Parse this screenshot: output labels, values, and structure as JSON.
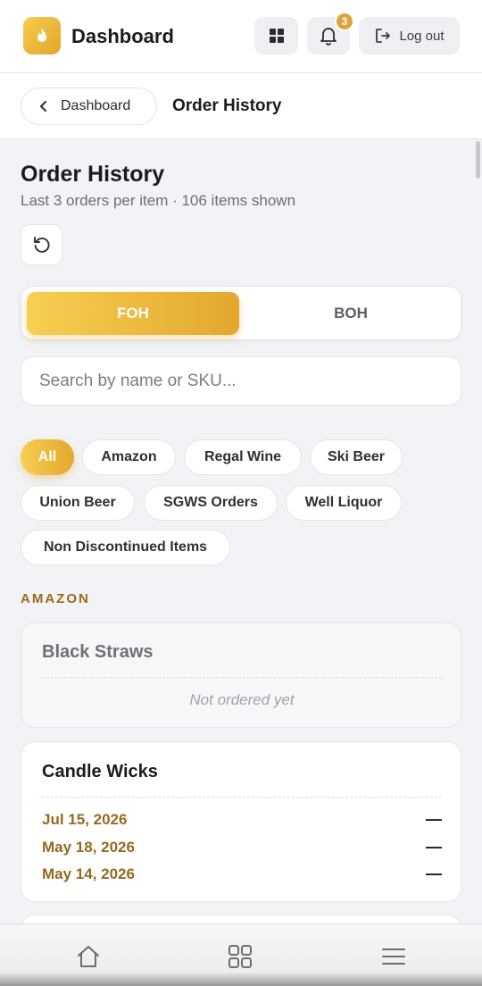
{
  "header": {
    "title": "Dashboard",
    "notification_count": "3",
    "logout_label": "Log out"
  },
  "breadcrumb": {
    "back_label": "Dashboard",
    "current": "Order History"
  },
  "page": {
    "title": "Order History",
    "subtitle": "Last 3 orders per item · 106 items shown"
  },
  "segments": {
    "foh": "FOH",
    "boh": "BOH",
    "active": "FOH"
  },
  "search": {
    "placeholder": "Search by name or SKU...",
    "value": ""
  },
  "filters": [
    "All",
    "Amazon",
    "Regal Wine",
    "Ski Beer",
    "Union Beer",
    "SGWS Orders",
    "Well Liquor",
    "Non Discontinued Items"
  ],
  "active_filter": "All",
  "section": {
    "label": "AMAZON",
    "items": [
      {
        "name": "Black Straws",
        "empty_text": "Not ordered yet"
      },
      {
        "name": "Candle Wicks",
        "orders": [
          {
            "date": "Jul 15, 2026",
            "qty": "—"
          },
          {
            "date": "May 18, 2026",
            "qty": "—"
          },
          {
            "date": "May 14, 2026",
            "qty": "—"
          }
        ]
      }
    ]
  },
  "colors": {
    "accent_start": "#f6cf52",
    "accent_end": "#e3a72e",
    "section_label": "#9a6a1b",
    "order_date": "#936a22"
  },
  "icons": {
    "logo": "flame-icon",
    "grid": "grid-icon",
    "bell": "bell-icon",
    "logout": "logout-icon",
    "back": "chevron-left-icon",
    "refresh": "refresh-icon",
    "nav_home": "home-icon",
    "nav_grid": "apps-icon",
    "nav_menu": "menu-icon"
  }
}
